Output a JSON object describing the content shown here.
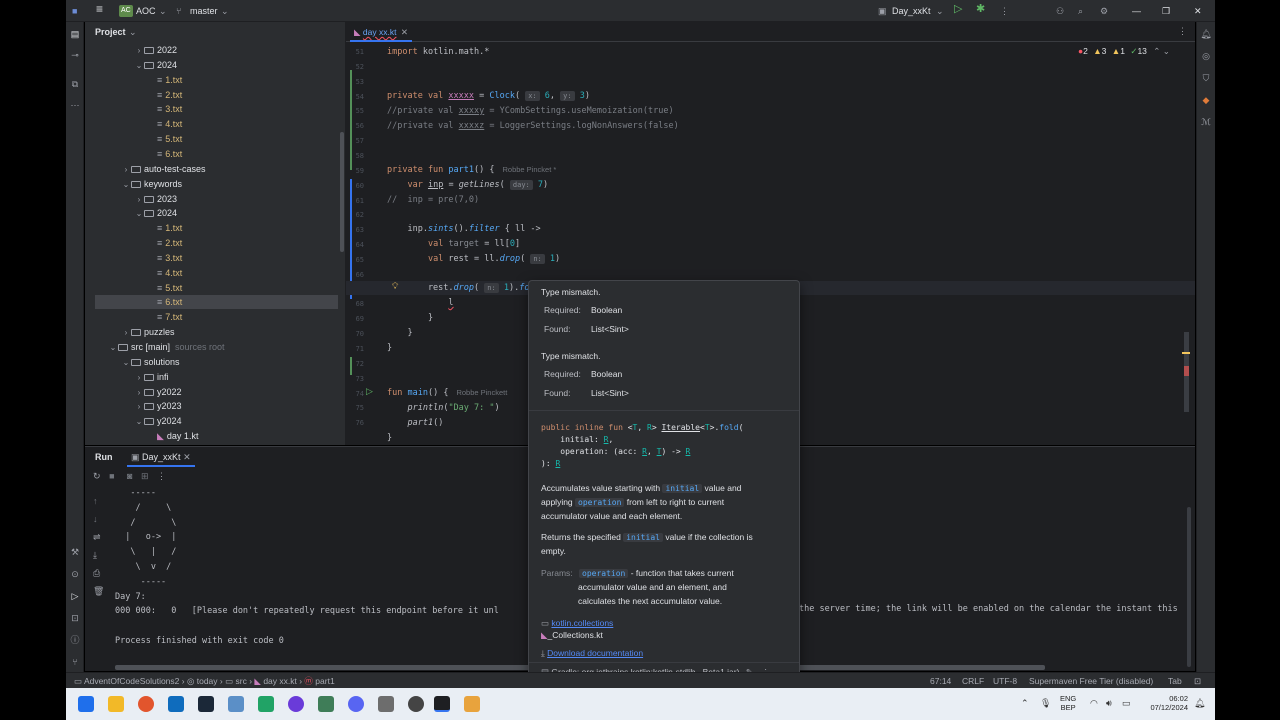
{
  "titlebar": {
    "project_badge": "AC",
    "project_name": "AOC",
    "branch_name": "master",
    "run_config": "Day_xxKt"
  },
  "project_panel": {
    "title": "Project",
    "tree": [
      {
        "label": "2022",
        "kind": "folder",
        "indent": 3,
        "chev": "›"
      },
      {
        "label": "2024",
        "kind": "folder",
        "indent": 3,
        "chev": "⌄"
      },
      {
        "label": "1.txt",
        "kind": "file",
        "indent": 4
      },
      {
        "label": "2.txt",
        "kind": "file",
        "indent": 4
      },
      {
        "label": "3.txt",
        "kind": "file",
        "indent": 4
      },
      {
        "label": "4.txt",
        "kind": "file",
        "indent": 4
      },
      {
        "label": "5.txt",
        "kind": "file",
        "indent": 4
      },
      {
        "label": "6.txt",
        "kind": "file",
        "indent": 4
      },
      {
        "label": "auto-test-cases",
        "kind": "folder",
        "indent": 2,
        "chev": "›"
      },
      {
        "label": "keywords",
        "kind": "folder",
        "indent": 2,
        "chev": "⌄"
      },
      {
        "label": "2023",
        "kind": "folder",
        "indent": 3,
        "chev": "›"
      },
      {
        "label": "2024",
        "kind": "folder",
        "indent": 3,
        "chev": "⌄"
      },
      {
        "label": "1.txt",
        "kind": "file",
        "indent": 4
      },
      {
        "label": "2.txt",
        "kind": "file",
        "indent": 4
      },
      {
        "label": "3.txt",
        "kind": "file",
        "indent": 4
      },
      {
        "label": "4.txt",
        "kind": "file",
        "indent": 4
      },
      {
        "label": "5.txt",
        "kind": "file",
        "indent": 4
      },
      {
        "label": "6.txt",
        "kind": "file",
        "indent": 4,
        "selected": true
      },
      {
        "label": "7.txt",
        "kind": "file",
        "indent": 4
      },
      {
        "label": "puzzles",
        "kind": "folder",
        "indent": 2,
        "chev": "›"
      },
      {
        "label": "src [main]",
        "kind": "folder",
        "indent": 1,
        "chev": "⌄",
        "suffix": "sources root"
      },
      {
        "label": "solutions",
        "kind": "folder",
        "indent": 2,
        "chev": "⌄"
      },
      {
        "label": "infi",
        "kind": "folder",
        "indent": 3,
        "chev": "›"
      },
      {
        "label": "y2022",
        "kind": "folder",
        "indent": 3,
        "chev": "›"
      },
      {
        "label": "y2023",
        "kind": "folder",
        "indent": 3,
        "chev": "›"
      },
      {
        "label": "y2024",
        "kind": "folder",
        "indent": 3,
        "chev": "⌄"
      },
      {
        "label": "day 1.kt",
        "kind": "kt",
        "indent": 4
      }
    ]
  },
  "editor": {
    "tab_label": "day xx.kt",
    "inspections": {
      "errors": "2",
      "warnings": "3",
      "weak": "1",
      "typos": "13"
    },
    "line_numbers": [
      "51",
      "52",
      "53",
      "54",
      "55",
      "56",
      "57",
      "58",
      "59",
      "60",
      "61",
      "62",
      "63",
      "64",
      "65",
      "66",
      "67",
      "68",
      "69",
      "70",
      "71",
      "72",
      "73",
      "74",
      "75",
      "76"
    ],
    "current_line": "67",
    "author": "Robbe Pincket *",
    "author2": "Robbe Pinckett"
  },
  "popup": {
    "err_title_1": "Type mismatch.",
    "req_label_1": "Required:",
    "req_val_1": "Boolean",
    "found_label_1": "Found:",
    "found_val_1": "List<Sint>",
    "err_title_2": "Type mismatch.",
    "req_label_2": "Required:",
    "req_val_2": "Boolean",
    "found_label_2": "Found:",
    "found_val_2": "List<Sint>",
    "doc_desc1a": "Accumulates value starting with",
    "doc_chip_initial": "initial",
    "doc_desc1b": "value and",
    "doc_desc1c": "applying",
    "doc_chip_operation": "operation",
    "doc_desc1d": "from left to right to current",
    "doc_desc1e": "accumulator value and each element.",
    "doc_desc2a": "Returns the specified",
    "doc_desc2b": "value if the collection is",
    "doc_desc2c": "empty.",
    "params_label": "Params:",
    "params_desc1": "- function that takes current",
    "params_desc2": "accumulator value and an element, and",
    "params_desc3": "calculates the next accumulator value.",
    "package_link": "kotlin.collections",
    "file_name": "_Collections.kt",
    "download_link": "Download documentation",
    "gradle_text": "Gradle: org.jetbrains.kotlin:kotlin-stdlib...Beta1.jar)"
  },
  "run_panel": {
    "run_label": "Run",
    "tab_label": "Day_xxKt",
    "output_lines": [
      "   -----",
      "    /     \\",
      "   /       \\",
      "  |   o->  |",
      "   \\   |   /",
      "    \\  v  /",
      "     -----",
      "Day 7:",
      "000 000:   0   [Please don't repeatedly request this endpoint before it unl",
      "",
      "Process finished with exit code 0"
    ],
    "output_tail": "the server time; the link will be enabled on the calendar the instant this"
  },
  "statusbar": {
    "crumbs": [
      "AdventOfCodeSolutions2",
      "today",
      "src",
      "day xx.kt",
      "part1"
    ],
    "position": "67:14",
    "line_sep": "CRLF",
    "encoding": "UTF-8",
    "license": "Supermaven Free Tier (disabled)",
    "indent": "Tab"
  },
  "taskbar": {
    "lang1": "ENG",
    "lang2": "BEP",
    "time": "06:02",
    "date": "07/12/2024"
  }
}
